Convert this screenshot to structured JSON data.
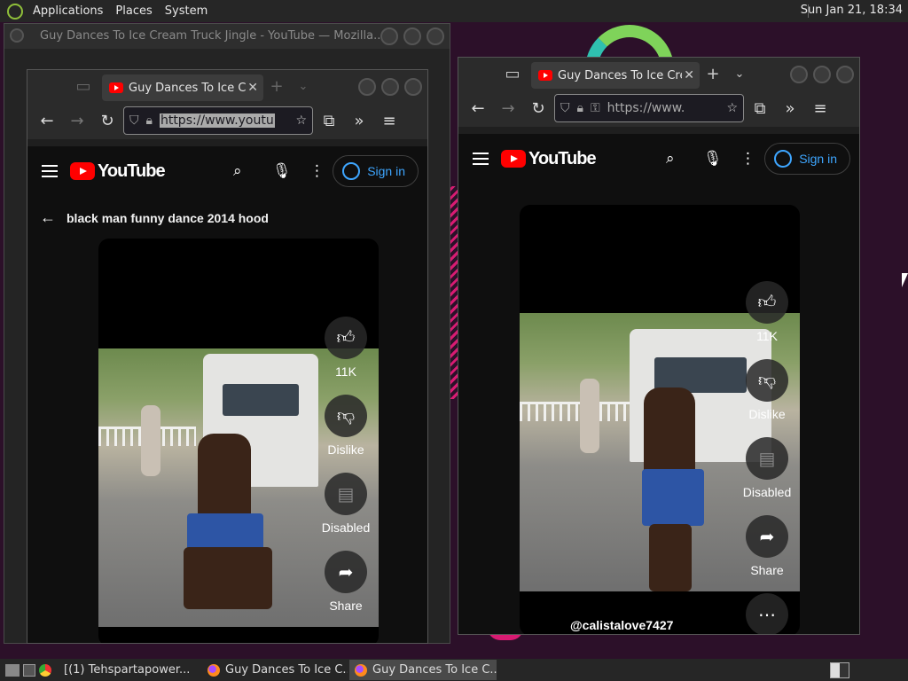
{
  "top_panel": {
    "menus": [
      "Applications",
      "Places",
      "System"
    ],
    "clock": "Sun Jan 21, 18:34"
  },
  "background_window": {
    "title": "Guy Dances To Ice Cream Truck Jingle - YouTube — Mozilla..."
  },
  "left_window": {
    "tab_title": "Guy Dances To Ice Cre",
    "url": "https://www.youtu",
    "page_title": "black man funny dance 2014 hood",
    "sign_in": "Sign in",
    "youtube_logo": "YouTube",
    "like_count": "11K",
    "dislike_label": "Dislike",
    "comments_label": "Disabled",
    "share_label": "Share"
  },
  "right_window": {
    "tab_title": "Guy Dances To Ice Crea",
    "url": "https://www.",
    "sign_in": "Sign in",
    "youtube_logo": "YouTube",
    "like_count": "11K",
    "dislike_label": "Dislike",
    "comments_label": "Disabled",
    "share_label": "Share",
    "channel_handle": "@calistalove7427"
  },
  "taskbar": {
    "items": [
      {
        "label": "[(1) Tehspartapower..."
      },
      {
        "label": "Guy Dances To Ice C..."
      },
      {
        "label": "Guy Dances To Ice C..."
      }
    ]
  },
  "colors": {
    "youtube_red": "#ff0000",
    "signin_blue": "#3ea6ff",
    "panel": "#262626"
  }
}
